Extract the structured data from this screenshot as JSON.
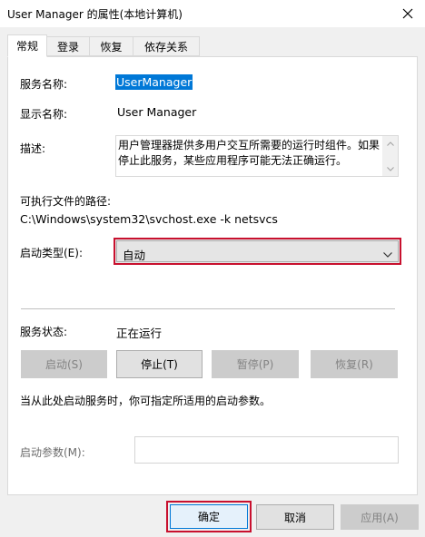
{
  "window": {
    "title": "User Manager 的属性(本地计算机)"
  },
  "tabs": [
    {
      "label": "常规",
      "active": true
    },
    {
      "label": "登录",
      "active": false
    },
    {
      "label": "恢复",
      "active": false
    },
    {
      "label": "依存关系",
      "active": false
    }
  ],
  "general": {
    "service_name_label": "服务名称:",
    "service_name_value": "UserManager",
    "display_name_label": "显示名称:",
    "display_name_value": "User Manager",
    "description_label": "描述:",
    "description_value": "用户管理器提供多用户交互所需要的运行时组件。如果停止此服务，某些应用程序可能无法正确运行。",
    "exe_path_label": "可执行文件的路径:",
    "exe_path_value": "C:\\Windows\\system32\\svchost.exe -k netsvcs",
    "startup_type_label": "启动类型(E):",
    "startup_type_value": "自动",
    "status_label": "服务状态:",
    "status_value": "正在运行",
    "buttons": {
      "start": "启动(S)",
      "stop": "停止(T)",
      "pause": "暂停(P)",
      "resume": "恢复(R)"
    },
    "hint": "当从此处启动服务时，你可指定所适用的启动参数。",
    "start_params_label": "启动参数(M):",
    "start_params_value": ""
  },
  "footer": {
    "ok": "确定",
    "cancel": "取消",
    "apply": "应用(A)"
  },
  "colors": {
    "highlight": "#0078d7",
    "annotation_red": "#c8102e"
  }
}
